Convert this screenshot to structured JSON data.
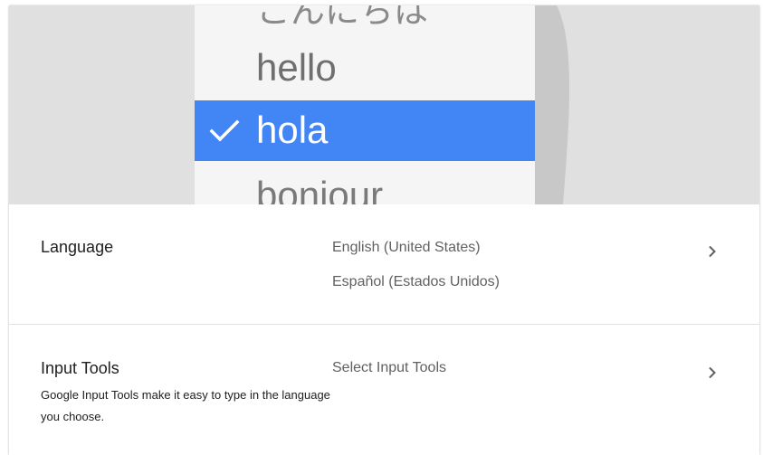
{
  "picker": {
    "words": {
      "top": "こんにちは",
      "hello": "hello",
      "selected": "hola",
      "bottom": "bonjour"
    },
    "selected_color": "#4285f4"
  },
  "language": {
    "title": "Language",
    "values": [
      "English (United States)",
      "Español (Estados Unidos)"
    ],
    "chevron_icon": "chevron-right-icon"
  },
  "input_tools": {
    "title": "Input Tools",
    "description": "Google Input Tools make it easy to type in the language you choose.",
    "value": "Select Input Tools",
    "chevron_icon": "chevron-right-icon"
  }
}
